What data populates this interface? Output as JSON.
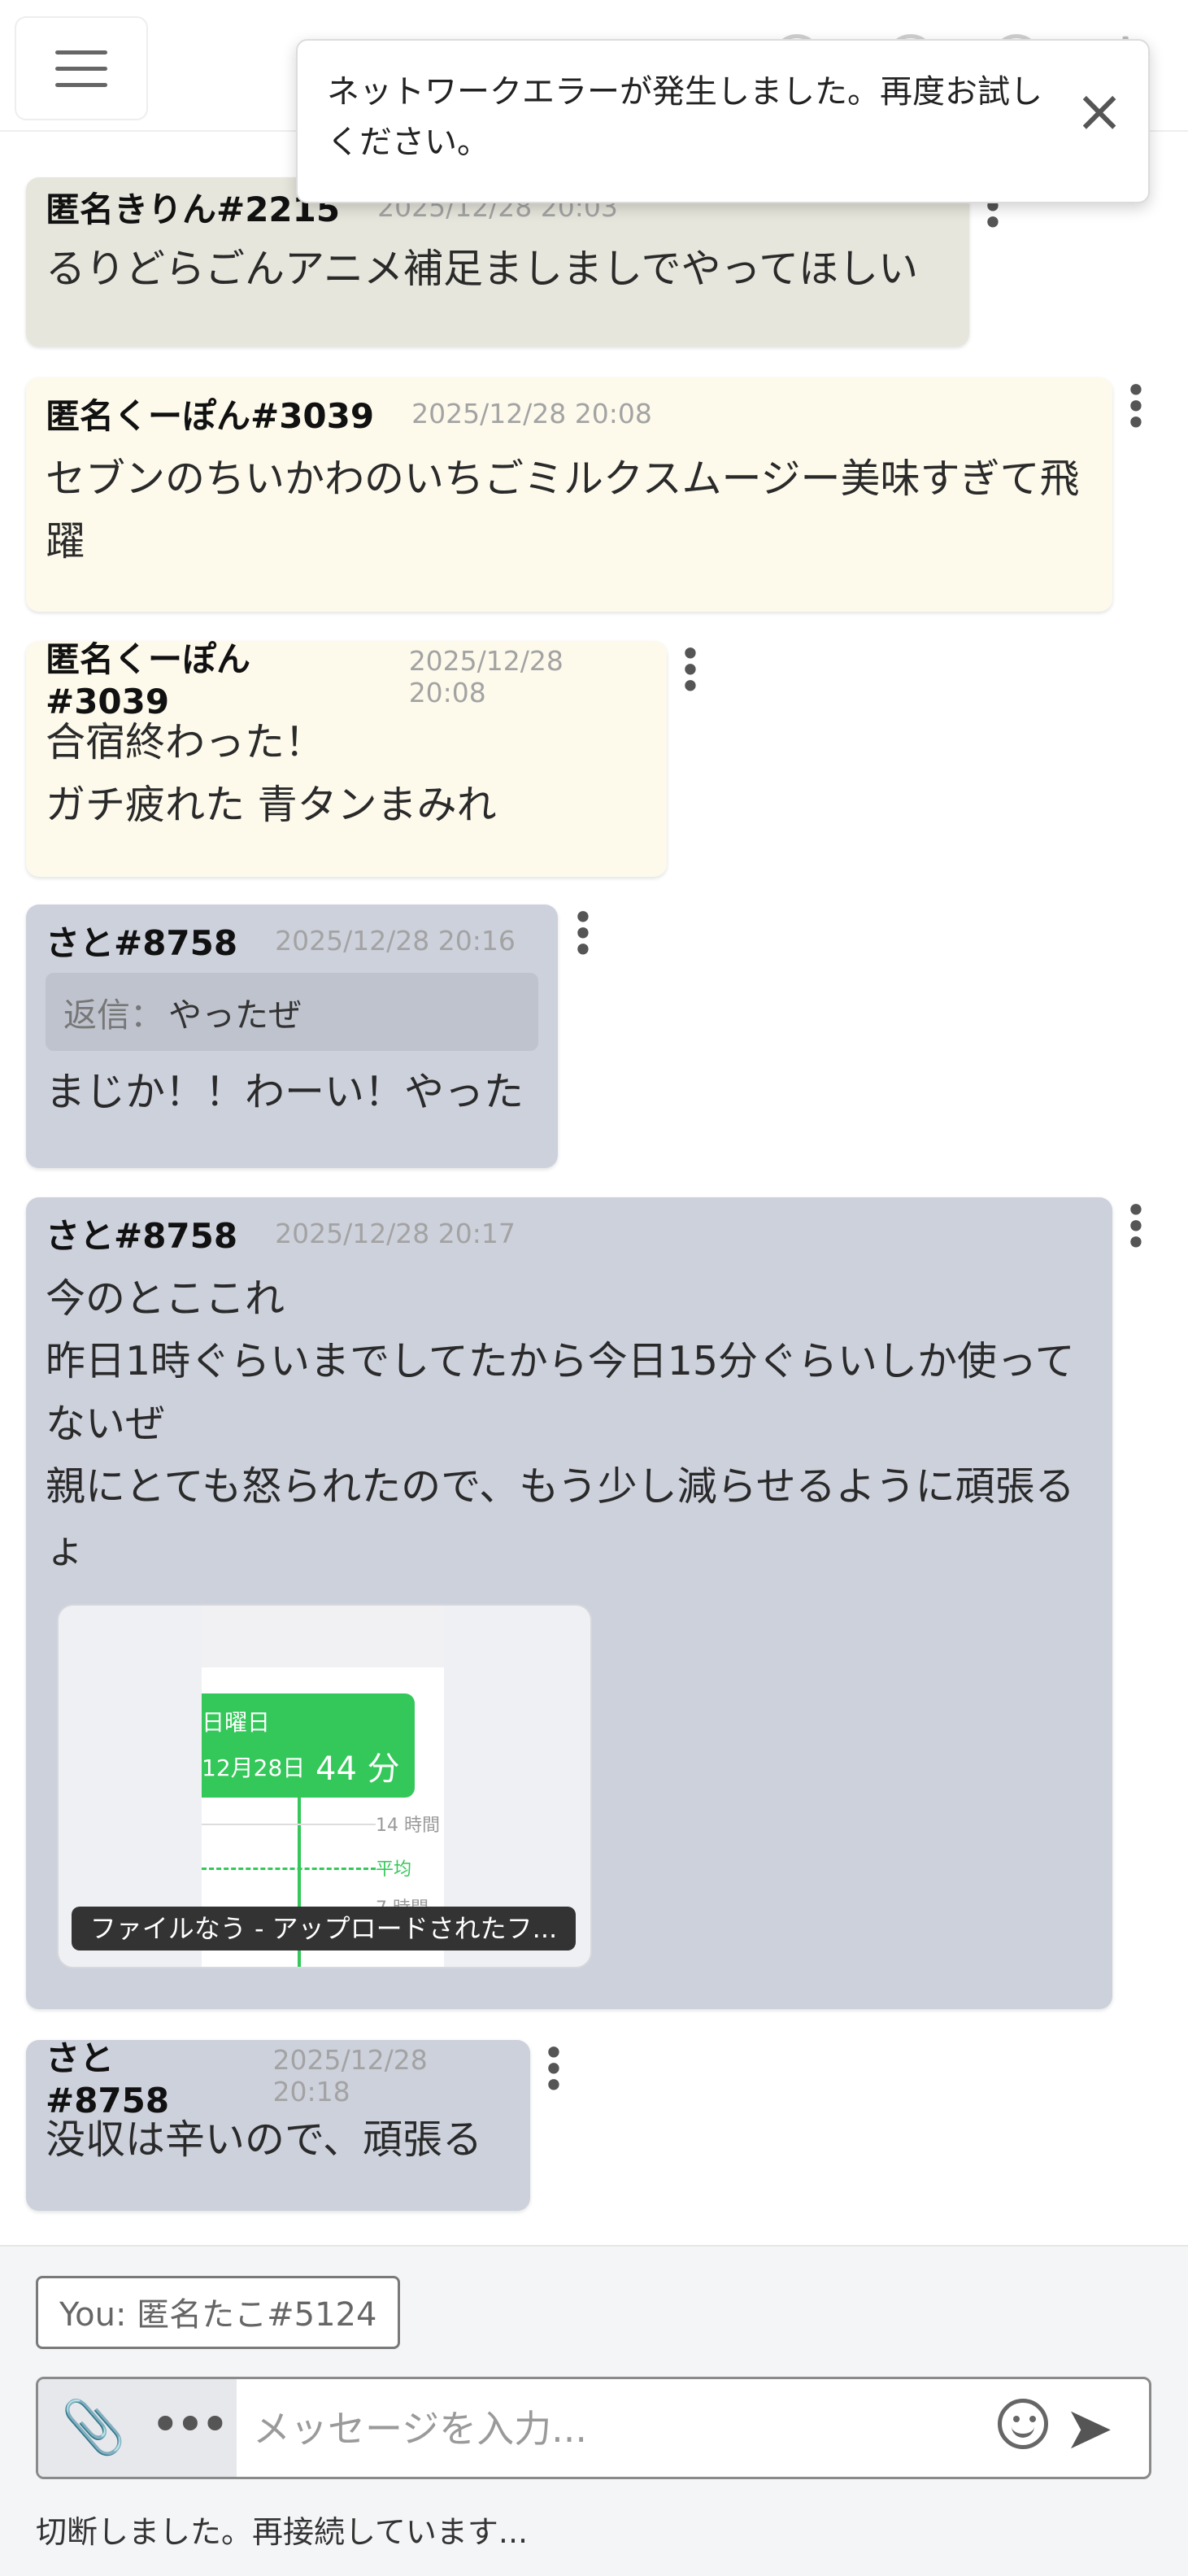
{
  "toast": {
    "text": "ネットワークエラーが発生しました。再度お試しください。"
  },
  "messages": [
    {
      "author": "匿名きりん#2215",
      "time": "2025/12/28 20:03",
      "text": "るりどらごんアニメ補足ましましでやってほしい"
    },
    {
      "author": "匿名くーぽん#3039",
      "time": "2025/12/28 20:08",
      "text": "セブンのちいかわのいちごミルクスムージー美味すぎて飛躍"
    },
    {
      "author": "匿名くーぽん#3039",
      "time": "2025/12/28 20:08",
      "text": "合宿終わった！\nガチ疲れた 青タンまみれ"
    },
    {
      "author": "さと#8758",
      "time": "2025/12/28 20:16",
      "reply_label": "返信：",
      "reply_text": "やったぜ",
      "text": "まじか！！わーい！やった"
    },
    {
      "author": "さと#8758",
      "time": "2025/12/28 20:17",
      "text": "今のとここれ\n昨日1時ぐらいまでしてたから今日15分ぐらいしか使ってないぜ\n親にとても怒られたので、もう少し減らせるように頑張るょ"
    },
    {
      "author": "さと#8758",
      "time": "2025/12/28 20:18",
      "text": "没収は辛いので、頑張る"
    }
  ],
  "attachment": {
    "caption": "ファイルなう - アップロードされたフ...",
    "thumb": {
      "day": "日曜日",
      "date": "12月28日",
      "duration": "44 分",
      "label_14": "14 時間",
      "label_avg": "平均",
      "label_7": "7 時間"
    }
  },
  "footer": {
    "you_label": "You: 匿名たこ#5124",
    "input_placeholder": "メッセージを入力...",
    "status": "切断しました。再接続しています..."
  }
}
